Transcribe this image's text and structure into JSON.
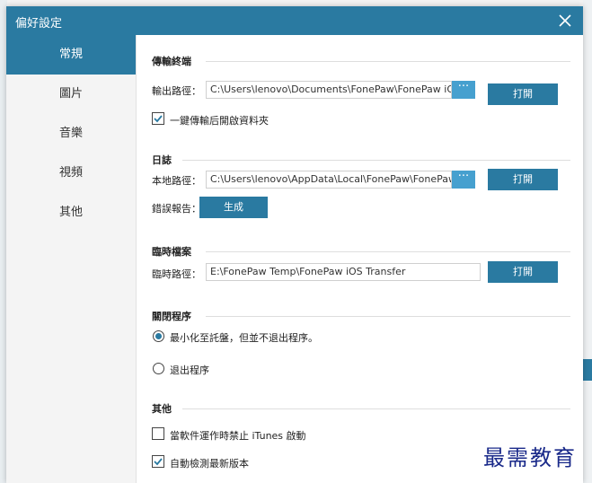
{
  "window": {
    "title": "偏好設定"
  },
  "sidebar": {
    "items": [
      {
        "label": "常規"
      },
      {
        "label": "圖片"
      },
      {
        "label": "音樂"
      },
      {
        "label": "視頻"
      },
      {
        "label": "其他"
      }
    ],
    "active_index": 0
  },
  "transfer": {
    "title": "傳輸終端",
    "output_label": "輸出路徑：",
    "output_path": "C:\\Users\\lenovo\\Documents\\FonePaw\\FonePaw iOS",
    "browse_label": "···",
    "open_label": "打開",
    "open_after_label": "一鍵傳輸后開啟資料夾",
    "open_after_checked": true
  },
  "log": {
    "title": "日誌",
    "local_label": "本地路徑：",
    "local_path": "C:\\Users\\lenovo\\AppData\\Local\\FonePaw\\FonePaw i",
    "browse_label": "···",
    "open_label": "打開",
    "error_label": "錯誤報告：",
    "generate_label": "生成"
  },
  "temp": {
    "title": "臨時檔案",
    "temp_label": "臨時路徑：",
    "temp_path": "E:\\FonePaw Temp\\FonePaw iOS Transfer",
    "open_label": "打開"
  },
  "close_program": {
    "title": "關閉程序",
    "option_minimize": "最小化至託盤，但並不退出程序。",
    "option_exit": "退出程序",
    "selected": "minimize"
  },
  "other": {
    "title": "其他",
    "itunes_label": "當軟件運作時禁止 iTunes 啟動",
    "itunes_checked": false,
    "update_label": "自動檢測最新版本",
    "update_checked": true
  },
  "watermark": "最需教育",
  "colors": {
    "accent": "#2a7aa1",
    "browse": "#46a0cf"
  }
}
